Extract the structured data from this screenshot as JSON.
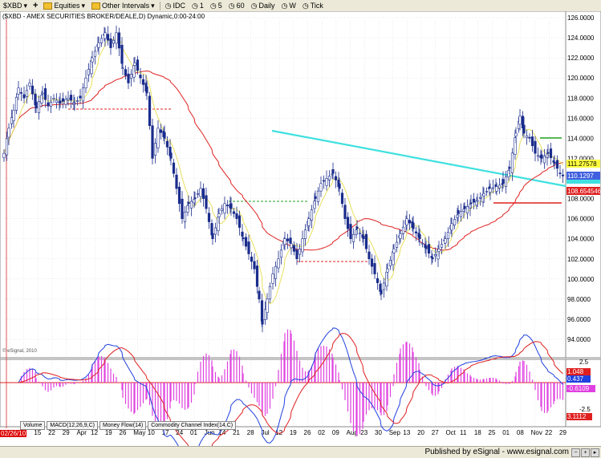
{
  "toolbar": {
    "symbol": "$XBD",
    "category": "Equities",
    "intervals_label": "Other Intervals",
    "idc": "IDC",
    "interval_1": "1",
    "interval_5": "5",
    "interval_60": "60",
    "daily": "Daily",
    "weekly": "W",
    "tick": "Tick"
  },
  "chart_title": "($XBD - AMEX SECURITIES BROKER/DEALE,D) Dynamic,0:00-24:00",
  "watermark": "© eSignal, 2010",
  "price_tags": {
    "yellow": "111.27578",
    "blue": "110.1297",
    "red": "108.654546"
  },
  "macd_tags": {
    "red": "1.048",
    "blue": "0.437",
    "purple": "-0.6109",
    "red2": "3.1112"
  },
  "tabs": [
    "Volume",
    "MACD(12,26,9,C)",
    "Money Flow(14)",
    "Commodity Channel Index(14,C)"
  ],
  "date_label": "02/26/10",
  "x_labels": [
    "Mar",
    "08",
    "15",
    "22",
    "29",
    "Apr",
    "12",
    "19",
    "26",
    "May",
    "10",
    "17",
    "24",
    "01",
    "Jun",
    "14",
    "21",
    "28",
    "Jul",
    "12",
    "19",
    "26",
    "02",
    "09",
    "Aug",
    "23",
    "30",
    "Sep",
    "13",
    "20",
    "27",
    "Oct",
    "11",
    "18",
    "25",
    "01",
    "08",
    "Nov",
    "22",
    "29"
  ],
  "y_labels": [
    "126.0000",
    "124.0000",
    "122.0000",
    "120.0000",
    "118.0000",
    "116.0000",
    "114.0000",
    "112.0000",
    "110.0000",
    "108.0000",
    "106.0000",
    "104.0000",
    "102.0000",
    "100.0000",
    "98.0000",
    "96.0000",
    "94.0000"
  ],
  "macd_y_labels": [
    "2.5",
    "-2.5"
  ],
  "status": "Published by eSignal - www.esignal.com",
  "colors": {
    "up": "#ffffff",
    "down": "#1a2c8c",
    "ma_red": "#e02020",
    "ma_yellow": "#e8e060",
    "cyan": "#40e0e0",
    "macd_hist": "#e040e0"
  }
}
